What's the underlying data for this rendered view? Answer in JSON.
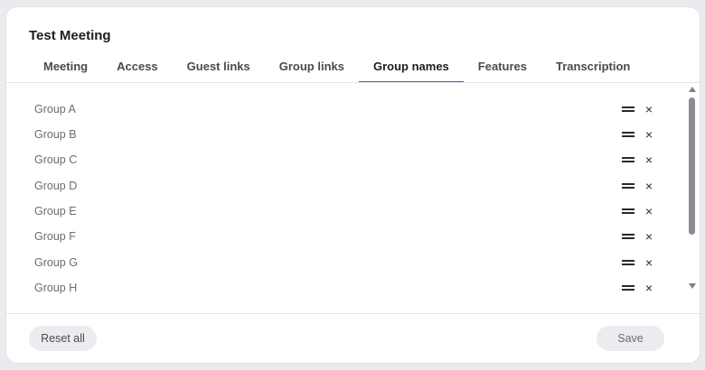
{
  "dialog": {
    "title": "Test Meeting"
  },
  "tabs": [
    {
      "label": "Meeting"
    },
    {
      "label": "Access"
    },
    {
      "label": "Guest links"
    },
    {
      "label": "Group links"
    },
    {
      "label": "Group names",
      "active": true
    },
    {
      "label": "Features"
    },
    {
      "label": "Transcription"
    }
  ],
  "groups": [
    {
      "name": "Group A"
    },
    {
      "name": "Group B"
    },
    {
      "name": "Group C"
    },
    {
      "name": "Group D"
    },
    {
      "name": "Group E"
    },
    {
      "name": "Group F"
    },
    {
      "name": "Group G"
    },
    {
      "name": "Group H"
    }
  ],
  "icons": {
    "drag": "drag-handle-icon",
    "remove": "close-icon",
    "remove_glyph": "×"
  },
  "footer": {
    "reset_label": "Reset all",
    "save_label": "Save"
  },
  "colors": {
    "accent": "#2b6fc2",
    "background": "#ebebef"
  }
}
